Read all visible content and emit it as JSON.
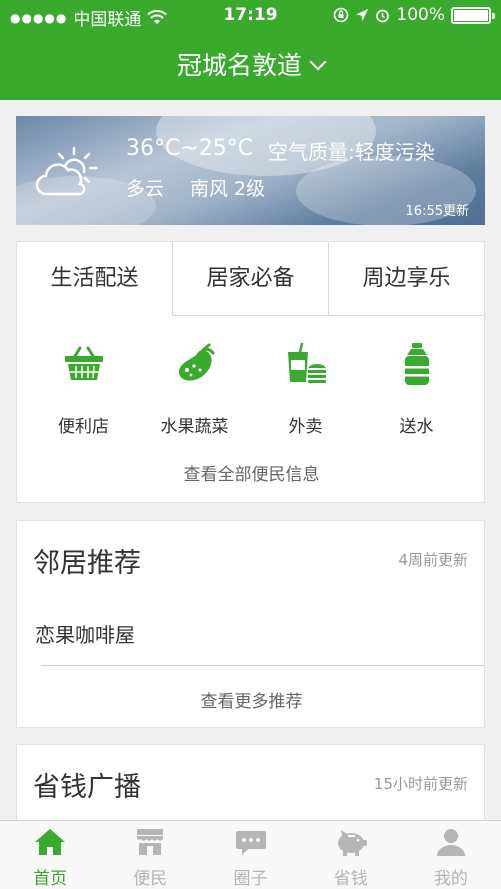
{
  "status_bar": {
    "signal": "●●●●●",
    "carrier": "中国联通",
    "time": "17:19",
    "battery": "100%",
    "battery_level": 1.0
  },
  "header": {
    "location": "冠城名敦道"
  },
  "weather": {
    "temperature": "36°C~25°C",
    "air_quality": "空气质量:轻度污染",
    "condition": "多云",
    "wind": "南风 2级",
    "updated": "16:55更新"
  },
  "services": {
    "tabs": [
      "生活配送",
      "居家必备",
      "周边享乐"
    ],
    "active_tab": 0,
    "items": [
      {
        "label": "便利店",
        "icon": "basket-icon"
      },
      {
        "label": "水果蔬菜",
        "icon": "eggplant-icon"
      },
      {
        "label": "外卖",
        "icon": "takeout-icon"
      },
      {
        "label": "送水",
        "icon": "water-bottle-icon"
      }
    ],
    "see_all": "查看全部便民信息"
  },
  "neighbor": {
    "title": "邻居推荐",
    "updated": "4周前更新",
    "items": [
      "恋果咖啡屋"
    ],
    "see_more": "查看更多推荐"
  },
  "savings": {
    "title": "省钱广播",
    "updated": "15小时前更新"
  },
  "tabbar": {
    "items": [
      {
        "label": "首页",
        "icon": "home-icon",
        "active": true
      },
      {
        "label": "便民",
        "icon": "shop-icon",
        "active": false
      },
      {
        "label": "圈子",
        "icon": "chat-icon",
        "active": false
      },
      {
        "label": "省钱",
        "icon": "piggy-bank-icon",
        "active": false
      },
      {
        "label": "我的",
        "icon": "user-icon",
        "active": false
      }
    ]
  },
  "colors": {
    "brand_green": "#3aaa2e",
    "inactive_gray": "#b5b5b5"
  }
}
